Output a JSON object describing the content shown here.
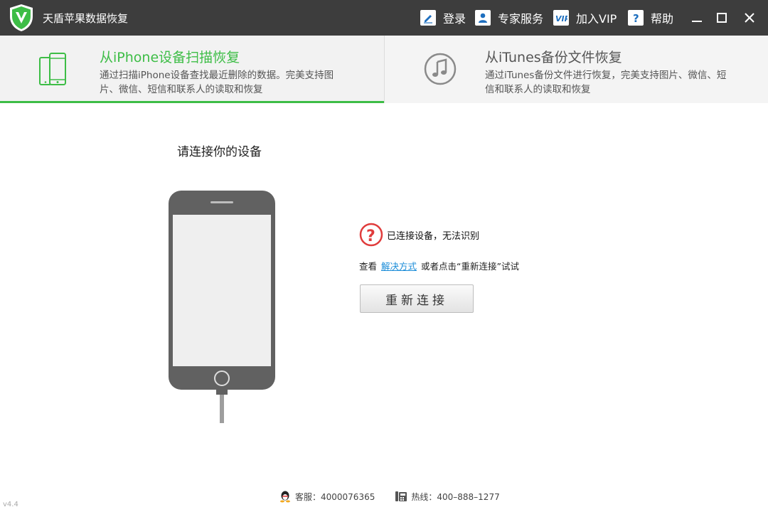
{
  "app": {
    "title": "天盾苹果数据恢复",
    "version": "v4.4"
  },
  "titlebar": {
    "actions": [
      {
        "label": "登录",
        "icon": "pencil-icon"
      },
      {
        "label": "专家服务",
        "icon": "expert-user-icon"
      },
      {
        "label": "加入VIP",
        "icon": "vip-icon"
      },
      {
        "label": "帮助",
        "icon": "help-icon"
      }
    ]
  },
  "tabs": [
    {
      "title": "从iPhone设备扫描恢复",
      "desc": "通过扫描iPhone设备查找最近删除的数据。完美支持图片、微信、短信和联系人的读取和恢复",
      "active": true
    },
    {
      "title": "从iTunes备份文件恢复",
      "desc": "通过iTunes备份文件进行恢复，完美支持图片、微信、短信和联系人的读取和恢复",
      "active": false
    }
  ],
  "main": {
    "prompt": "请连接你的设备",
    "status": "已连接设备，无法识别",
    "hint_prefix": "查看",
    "hint_link": "解决方式",
    "hint_suffix": "或者点击“重新连接”试试",
    "reconnect_label": "重新连接"
  },
  "footer": {
    "service": "客服：4000076365",
    "hotline": "热线：400–888–1277"
  },
  "colors": {
    "accent": "#3dbd46",
    "titlebar": "#3d3d3d",
    "error": "#e03c3c",
    "link": "#1a8cd8",
    "phone": "#616161"
  }
}
